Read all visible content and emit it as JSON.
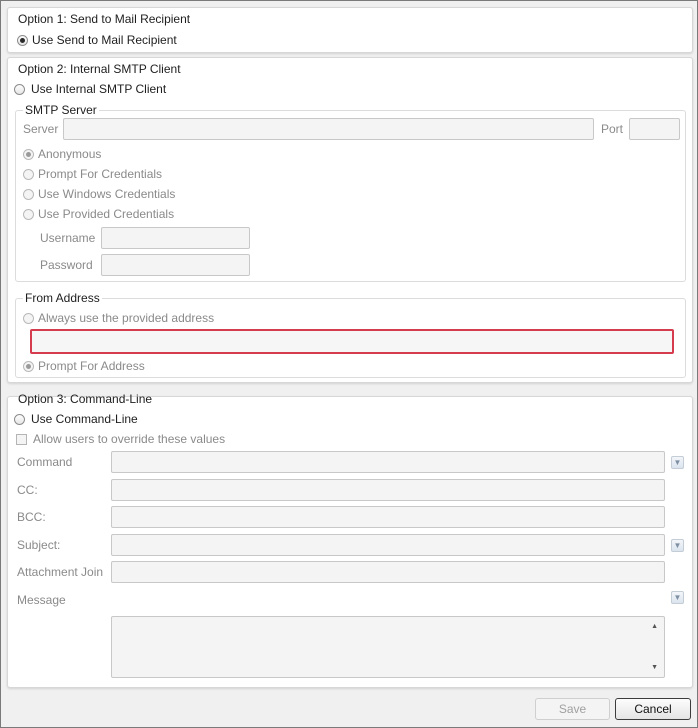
{
  "option1": {
    "title": "Option 1: Send to Mail Recipient",
    "radio_label": "Use Send to Mail Recipient",
    "selected": true
  },
  "option2": {
    "title": "Option 2: Internal SMTP Client",
    "radio_label": "Use Internal SMTP Client",
    "smtp_server": {
      "legend": "SMTP Server",
      "server_label": "Server",
      "server_value": "",
      "port_label": "Port",
      "port_value": "",
      "auth_options": [
        "Anonymous",
        "Prompt For Credentials",
        "Use Windows Credentials",
        "Use Provided Credentials"
      ],
      "selected_auth": "Anonymous",
      "username_label": "Username",
      "username_value": "",
      "password_label": "Password",
      "password_value": ""
    },
    "from_address": {
      "legend": "From Address",
      "always_label": "Always use the provided address",
      "address_value": "",
      "prompt_label": "Prompt For Address",
      "selected": "Prompt For Address"
    }
  },
  "option3": {
    "title": "Option 3: Command-Line",
    "radio_label": "Use Command-Line",
    "override_label": "Allow users to override these values",
    "fields": {
      "command_label": "Command",
      "cc_label": "CC:",
      "bcc_label": "BCC:",
      "subject_label": "Subject:",
      "attachment_join_label": "Attachment Join",
      "message_label": "Message"
    }
  },
  "buttons": {
    "save": "Save",
    "cancel": "Cancel"
  },
  "colors": {
    "error_border": "#d53c4e",
    "panel_bg": "#ffffff",
    "window_bg": "#f0f0f0"
  }
}
